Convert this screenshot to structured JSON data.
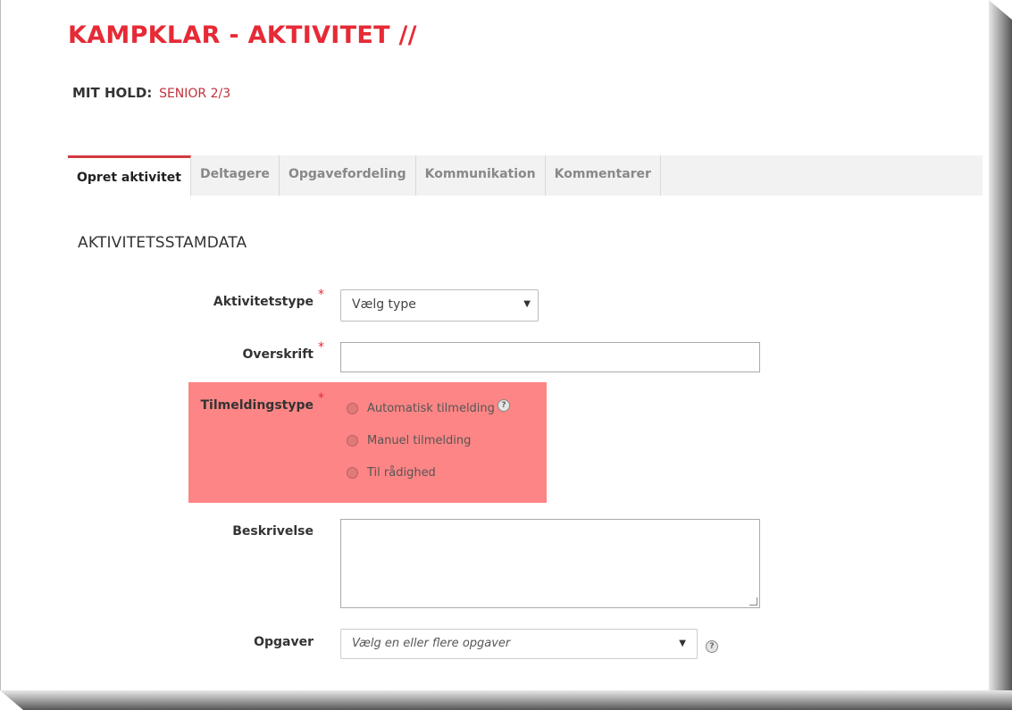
{
  "header": {
    "title": "KAMPKLAR - AKTIVITET //",
    "team_label": "MIT HOLD:",
    "team_value": "SENIOR 2/3"
  },
  "tabs": [
    {
      "label": "Opret aktivitet",
      "active": true
    },
    {
      "label": "Deltagere",
      "active": false
    },
    {
      "label": "Opgavefordeling",
      "active": false
    },
    {
      "label": "Kommunikation",
      "active": false
    },
    {
      "label": "Kommentarer",
      "active": false
    }
  ],
  "section": {
    "title": "AKTIVITETSSTAMDATA"
  },
  "form": {
    "required_mark": "*",
    "activity_type": {
      "label": "Aktivitetstype",
      "value": "Vælg type"
    },
    "heading": {
      "label": "Overskrift",
      "value": ""
    },
    "signup_type": {
      "label": "Tilmeldingstype",
      "options": [
        "Automatisk tilmelding",
        "Manuel tilmelding",
        "Til rådighed"
      ],
      "help_icon": "question-icon"
    },
    "description": {
      "label": "Beskrivelse",
      "value": ""
    },
    "tasks": {
      "label": "Opgaver",
      "placeholder": "Vælg en eller flere opgaver",
      "help_icon": "question-icon"
    }
  },
  "colors": {
    "brand_red": "#e62a36",
    "highlight": "#fd8585",
    "tab_bar": "#f2f2f2"
  }
}
